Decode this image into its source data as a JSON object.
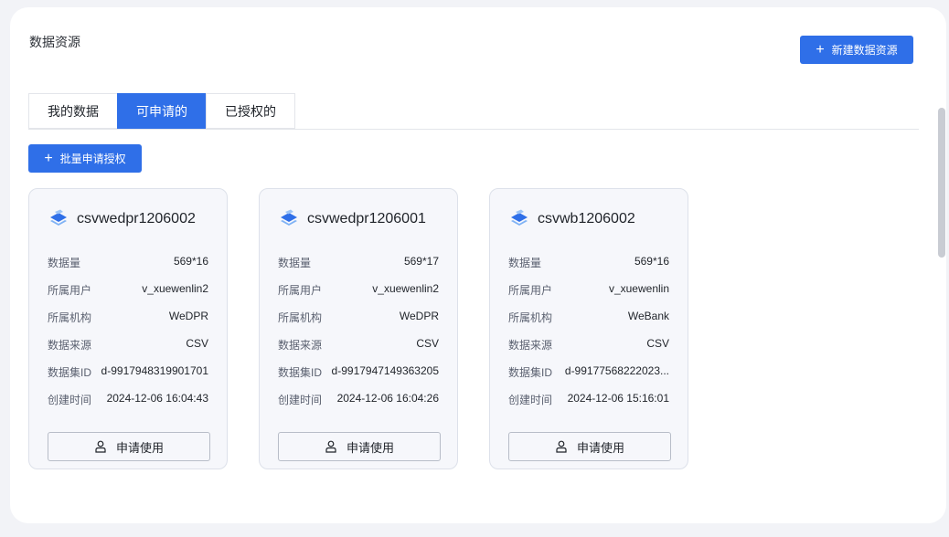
{
  "page": {
    "title": "数据资源",
    "new_button": "新建数据资源",
    "batch_button": "批量申请授权"
  },
  "tabs": [
    {
      "label": "我的数据",
      "active": false
    },
    {
      "label": "可申请的",
      "active": true
    },
    {
      "label": "已授权的",
      "active": false
    }
  ],
  "field_labels": {
    "volume": "数据量",
    "owner": "所属用户",
    "org": "所属机构",
    "source": "数据来源",
    "dataset_id": "数据集ID",
    "created": "创建时间"
  },
  "cards": [
    {
      "name": "csvwedpr1206002",
      "volume": "569*16",
      "owner": "v_xuewenlin2",
      "org": "WeDPR",
      "source": "CSV",
      "dataset_id": "d-9917948319901701",
      "created": "2024-12-06 16:04:43",
      "apply_label": "申请使用"
    },
    {
      "name": "csvwedpr1206001",
      "volume": "569*17",
      "owner": "v_xuewenlin2",
      "org": "WeDPR",
      "source": "CSV",
      "dataset_id": "d-9917947149363205",
      "created": "2024-12-06 16:04:26",
      "apply_label": "申请使用"
    },
    {
      "name": "csvwb1206002",
      "volume": "569*16",
      "owner": "v_xuewenlin",
      "org": "WeBank",
      "source": "CSV",
      "dataset_id": "d-99177568222023...",
      "created": "2024-12-06 15:16:01",
      "apply_label": "申请使用"
    }
  ],
  "icons": {
    "dataset": "dataset-layers-icon",
    "apply": "user-icon",
    "plus": "plus-icon"
  },
  "colors": {
    "primary": "#2f6fe8",
    "card_bg": "#f6f7fb"
  }
}
